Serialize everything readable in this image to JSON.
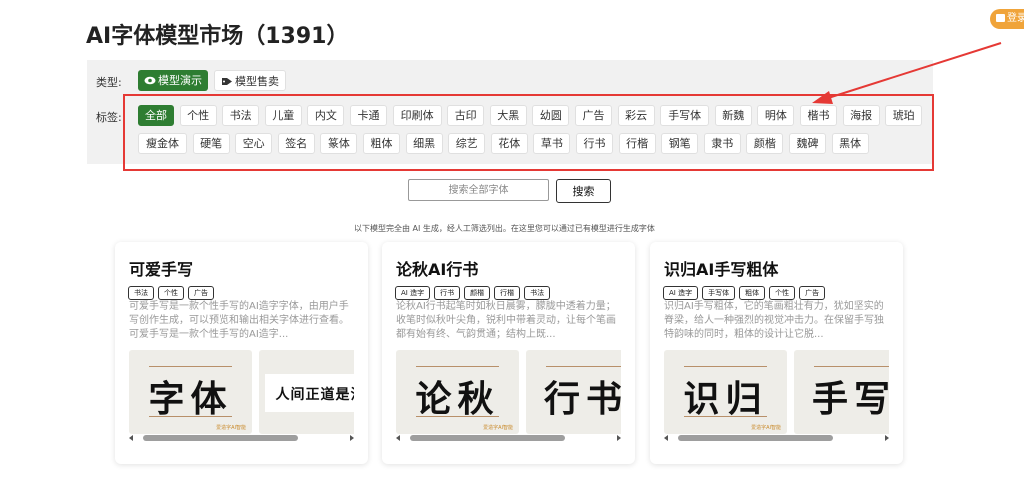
{
  "page": {
    "title": "AI字体模型市场（1391）",
    "login_label": "登录"
  },
  "filters": {
    "type_label": "类型:",
    "types": [
      {
        "label": "模型演示",
        "icon": "eye-icon",
        "active": true
      },
      {
        "label": "模型售卖",
        "icon": "tag-icon",
        "active": false
      }
    ],
    "tags_label": "标签:",
    "tags_row1": [
      "全部",
      "个性",
      "书法",
      "儿童",
      "内文",
      "卡通",
      "印刷体",
      "古印",
      "大黑",
      "幼圆",
      "广告",
      "彩云",
      "手写体",
      "新魏",
      "明体",
      "楷书",
      "海报",
      "琥珀"
    ],
    "tags_row2": [
      "瘦金体",
      "硬笔",
      "空心",
      "签名",
      "篆体",
      "粗体",
      "细黑",
      "综艺",
      "花体",
      "草书",
      "行书",
      "行楷",
      "钢笔",
      "隶书",
      "颜楷",
      "魏碑",
      "黑体"
    ],
    "active_tag": "全部"
  },
  "search": {
    "placeholder": "搜索全部字体",
    "button_label": "搜索"
  },
  "notice": "以下模型完全由 AI 生成，经人工筛选列出。在这里您可以通过已有模型进行生成字体",
  "cards": [
    {
      "title": "可爱手写",
      "tags": [
        "书法",
        "个性",
        "广告"
      ],
      "description": "可爱手写是一款个性手写的AI造字字体，由用户手写创作生成，可以预览和输出相关字体进行查看。可爱手写是一款个性手写的AI造字...",
      "preview1": "字体",
      "preview2": "人间正道是沧",
      "brand": "爱造字AI智能"
    },
    {
      "title": "论秋AI行书",
      "tags": [
        "AI 造字",
        "行书",
        "颜楷",
        "行楷",
        "书法"
      ],
      "description": "论秋AI行书起笔时如秋日晨雾，朦胧中透着力量；收笔时似秋叶尖角，锐利中带着灵动，让每个笔画都有始有终、气韵贯通；结构上既...",
      "preview1": "论秋",
      "preview2": "行书",
      "brand": "爱造字AI智能"
    },
    {
      "title": "识归AI手写粗体",
      "tags": [
        "AI 造字",
        "手写体",
        "粗体",
        "个性",
        "广告"
      ],
      "description": "识归AI手写粗体，它的笔画粗壮有力，犹如坚实的脊梁，给人一种强烈的视觉冲击力。在保留手写独特韵味的同时，粗体的设计让它脱...",
      "preview1": "识归",
      "preview2": "手写",
      "brand": "爱造字AI智能"
    }
  ],
  "colors": {
    "accent_green": "#2e7d32",
    "annotation_red": "#e53935",
    "login_orange": "#f0a43a"
  }
}
